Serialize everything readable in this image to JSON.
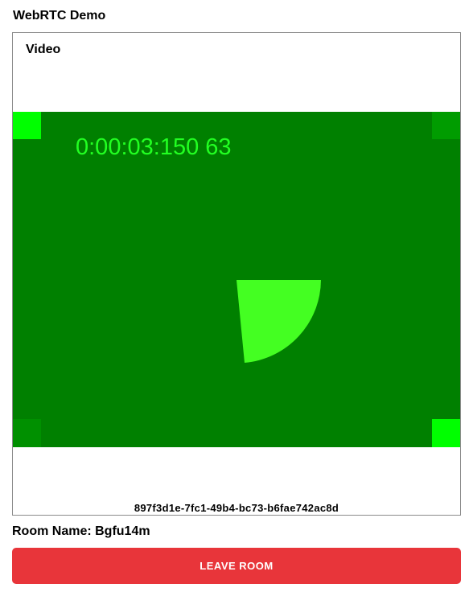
{
  "app": {
    "title": "WebRTC Demo"
  },
  "video_panel": {
    "heading": "Video",
    "stream": {
      "timestamp_text": "0:00:03:150 63",
      "background_color": "#008000",
      "marker_color": "#00ff00",
      "pie_color": "#44ff22",
      "pie_sweep_fraction": 0.25
    },
    "peer_id": "897f3d1e-7fc1-49b4-bc73-b6fae742ac8d"
  },
  "room": {
    "label": "Room Name: Bgfu14m"
  },
  "actions": {
    "leave_label": "LEAVE ROOM",
    "leave_color": "#e8353a"
  }
}
